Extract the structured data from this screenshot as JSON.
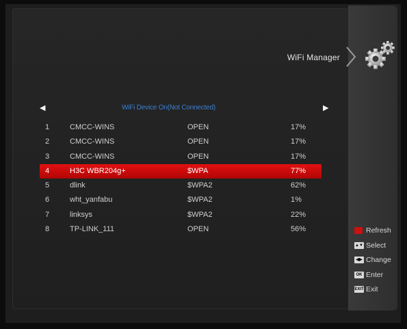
{
  "header": {
    "title": "WiFi Manager"
  },
  "status": {
    "text": "WiFi Device On(Not Connected)"
  },
  "networks": [
    {
      "num": "1",
      "ssid": "CMCC-WINS",
      "security": "OPEN",
      "signal": "17%"
    },
    {
      "num": "2",
      "ssid": "CMCC-WINS",
      "security": "OPEN",
      "signal": "17%"
    },
    {
      "num": "3",
      "ssid": "CMCC-WINS",
      "security": "OPEN",
      "signal": "17%"
    },
    {
      "num": "4",
      "ssid": "H3C WBR204g+",
      "security": "$WPA",
      "signal": "77%"
    },
    {
      "num": "5",
      "ssid": "dlink",
      "security": "$WPA2",
      "signal": "62%"
    },
    {
      "num": "6",
      "ssid": "wht_yanfabu",
      "security": "$WPA2",
      "signal": "1%"
    },
    {
      "num": "7",
      "ssid": "linksys",
      "security": "$WPA2",
      "signal": "22%"
    },
    {
      "num": "8",
      "ssid": "TP-LINK_111",
      "security": "OPEN",
      "signal": "56%"
    }
  ],
  "selected_index": 3,
  "legend": {
    "refresh": {
      "key": "",
      "label": "Refresh",
      "key_color": "#cc1111"
    },
    "select": {
      "key": "▲▼",
      "label": "Select"
    },
    "change": {
      "key": "◀▶",
      "label": "Change"
    },
    "enter": {
      "key": "OK",
      "label": "Enter"
    },
    "exit": {
      "key": "EXIT",
      "label": "Exit"
    }
  },
  "icons": {
    "left_arrow": "left-arrow-icon",
    "right_arrow": "right-arrow-icon",
    "gear": "gears-icon"
  },
  "colors": {
    "selection": "#e21010",
    "status_text": "#3d7fd0"
  }
}
